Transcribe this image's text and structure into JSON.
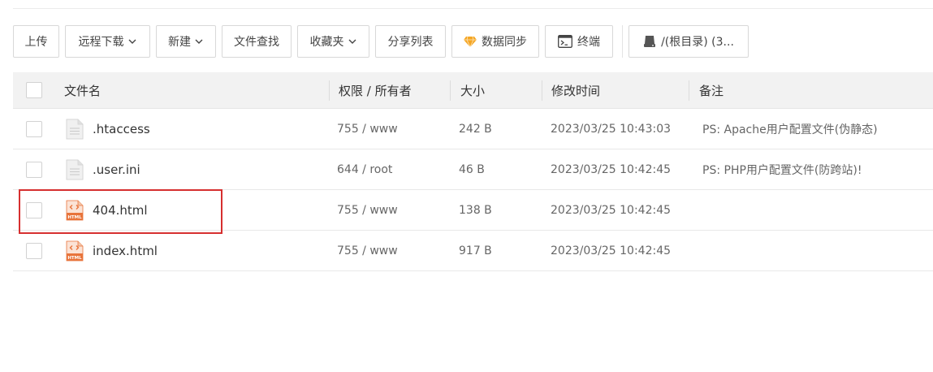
{
  "toolbar": {
    "upload": "上传",
    "remote_download": "远程下载",
    "new": "新建",
    "file_search": "文件查找",
    "favorites": "收藏夹",
    "share_list": "分享列表",
    "data_sync": "数据同步",
    "terminal": "终端",
    "disk": "/(根目录) (3..."
  },
  "table": {
    "headers": {
      "name": "文件名",
      "perm": "权限 / 所有者",
      "size": "大小",
      "mtime": "修改时间",
      "note": "备注"
    },
    "rows": [
      {
        "name": ".htaccess",
        "icon": "text-file-icon",
        "perm": "755 / www",
        "size": "242 B",
        "mtime": "2023/03/25 10:43:03",
        "note": "PS: Apache用户配置文件(伪静态)"
      },
      {
        "name": ".user.ini",
        "icon": "text-file-icon",
        "perm": "644 / root",
        "size": "46 B",
        "mtime": "2023/03/25 10:42:45",
        "note": "PS: PHP用户配置文件(防跨站)!"
      },
      {
        "name": "404.html",
        "icon": "html-file-icon",
        "perm": "755 / www",
        "size": "138 B",
        "mtime": "2023/03/25 10:42:45",
        "note": ""
      },
      {
        "name": "index.html",
        "icon": "html-file-icon",
        "perm": "755 / www",
        "size": "917 B",
        "mtime": "2023/03/25 10:42:45",
        "note": ""
      }
    ]
  },
  "icons": {
    "html_badge": "HTML"
  },
  "colors": {
    "highlight": "#d62f2f",
    "html_icon": "#e8743b",
    "gem": "#f5a623"
  }
}
